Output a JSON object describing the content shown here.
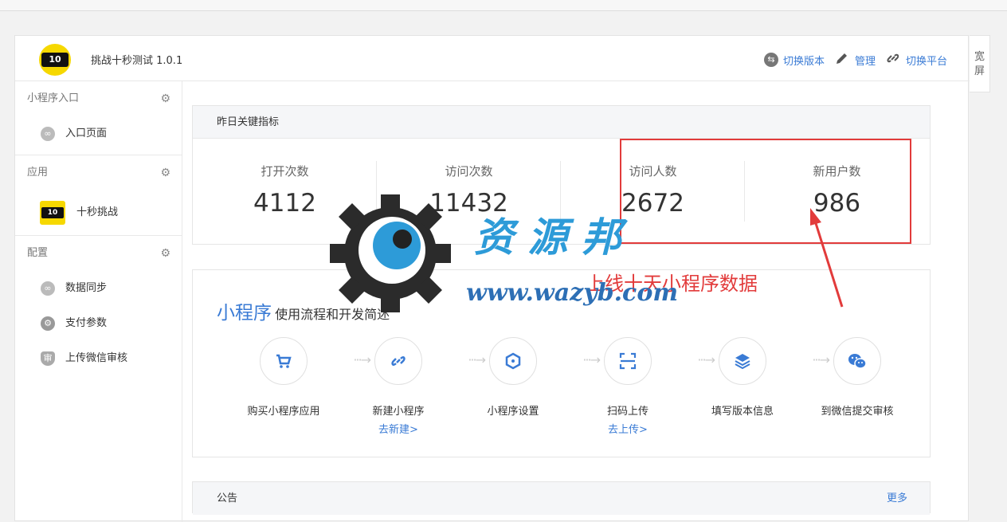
{
  "header": {
    "app_title": "挑战十秒测试 1.0.1",
    "logo_text": "10",
    "switch_version": "切换版本",
    "manage": "管理",
    "switch_platform": "切换平台"
  },
  "wide_screen": "宽屏",
  "sidebar": {
    "sections": [
      {
        "title": "小程序入口",
        "items": [
          {
            "label": "入口页面",
            "icon": "link-icon"
          }
        ]
      },
      {
        "title": "应用",
        "items": [
          {
            "label": "十秒挑战",
            "icon": "app-logo"
          }
        ]
      },
      {
        "title": "配置",
        "items": [
          {
            "label": "数据同步",
            "icon": "link-icon"
          },
          {
            "label": "支付参数",
            "icon": "gear-icon"
          },
          {
            "label": "上传微信审核",
            "icon": "shield-icon"
          }
        ]
      }
    ]
  },
  "metrics_card": {
    "title": "昨日关键指标",
    "items": [
      {
        "label": "打开次数",
        "value": "4112"
      },
      {
        "label": "访问次数",
        "value": "11432"
      },
      {
        "label": "访问人数",
        "value": "2672"
      },
      {
        "label": "新用户数",
        "value": "986"
      }
    ]
  },
  "flow_card": {
    "title_big": "小程序",
    "title_small": "使用流程和开发简述",
    "steps": [
      {
        "label": "购买小程序应用",
        "sub": "",
        "icon": "cart-icon"
      },
      {
        "label": "新建小程序",
        "sub": "去新建>",
        "icon": "link-icon"
      },
      {
        "label": "小程序设置",
        "sub": "",
        "icon": "hexagon-icon"
      },
      {
        "label": "扫码上传",
        "sub": "去上传>",
        "icon": "scan-icon"
      },
      {
        "label": "填写版本信息",
        "sub": "",
        "icon": "layers-icon"
      },
      {
        "label": "到微信提交审核",
        "sub": "",
        "icon": "wechat-icon"
      }
    ]
  },
  "notice_card": {
    "title": "公告",
    "more": "更多"
  },
  "annotation": "上线十天小程序数据",
  "watermark": {
    "cn": "资 源 邦",
    "url": "www.wazyb.com"
  }
}
